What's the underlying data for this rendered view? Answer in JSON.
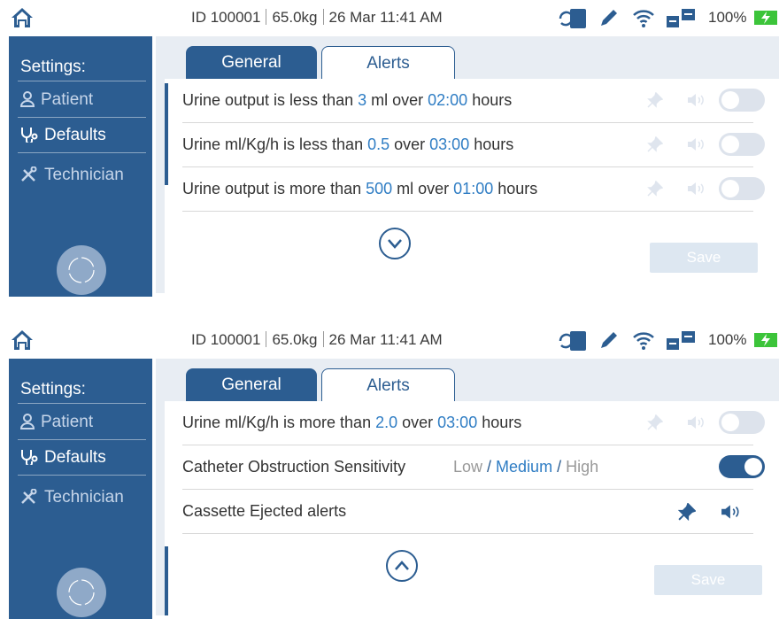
{
  "colors": {
    "accent": "#2c5d91",
    "value": "#2f7dc4",
    "battery": "#3cc43a"
  },
  "status": {
    "patient_id": "ID 100001",
    "weight": "65.0kg",
    "datetime": "26 Mar  11:41 AM",
    "battery": "100%"
  },
  "sidebar": {
    "title": "Settings:",
    "patient": "Patient",
    "defaults": "Defaults",
    "technician": "Technician"
  },
  "tabs": {
    "general": "General",
    "alerts": "Alerts"
  },
  "save_label": "Save",
  "screen1": {
    "rows": [
      {
        "a": "Urine output is less than ",
        "b": "3",
        "c": " ml over ",
        "d": "02:00",
        "e": " hours"
      },
      {
        "a": "Urine ml/Kg/h is less than ",
        "b": "0.5",
        "c": " over ",
        "d": "03:00",
        "e": " hours"
      },
      {
        "a": "Urine output is more than ",
        "b": "500",
        "c": " ml over ",
        "d": "01:00",
        "e": " hours"
      }
    ]
  },
  "screen2": {
    "row1": {
      "a": "Urine ml/Kg/h is more than ",
      "b": "2.0",
      "c": " over ",
      "d": "03:00",
      "e": " hours"
    },
    "sensitivity": {
      "label": "Catheter Obstruction Sensitivity",
      "low": "Low",
      "sep": " / ",
      "medium": "Medium",
      "high": "High"
    },
    "cassette": "Cassette Ejected alerts"
  }
}
